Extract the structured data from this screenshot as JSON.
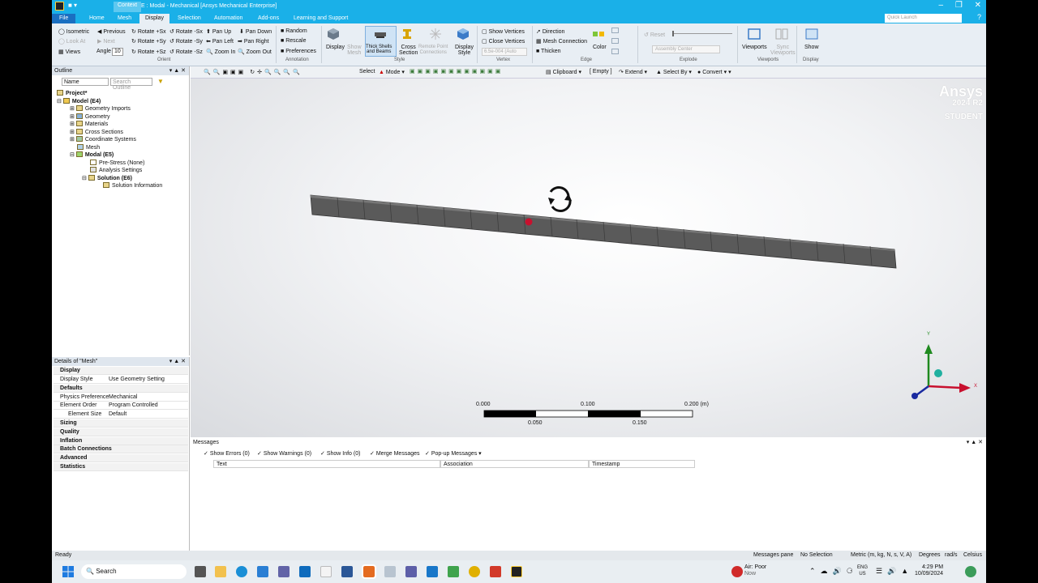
{
  "window": {
    "context_tab": "Context",
    "title": "E : Modal - Mechanical [Ansys Mechanical Enterprise]",
    "controls": [
      "–",
      "❐",
      "✕"
    ],
    "quick_launch_placeholder": "Quick Launch"
  },
  "ribbon_tabs": [
    "File",
    "Home",
    "Mesh",
    "Display",
    "Selection",
    "Automation",
    "Add-ons",
    "Learning and Support"
  ],
  "active_tab": "Display",
  "ribbon": {
    "orient": {
      "isometric": "Isometric",
      "previous": "Previous",
      "rotate_px": "Rotate +Sx",
      "rotate_mx": "Rotate -Sx",
      "pan_up": "Pan Up",
      "pan_down": "Pan Down",
      "look_at": "Look At",
      "next": "Next",
      "rotate_py": "Rotate +Sy",
      "rotate_my": "Rotate -Sy",
      "pan_left": "Pan Left",
      "pan_right": "Pan Right",
      "views": "Views",
      "angle_label": "Angle",
      "angle_value": "10",
      "rotate_pz": "Rotate +Sz",
      "rotate_mz": "Rotate -Sz",
      "zoom_in": "Zoom In",
      "zoom_out": "Zoom Out",
      "group": "Orient"
    },
    "annotation": {
      "random": "Random",
      "rescale": "Rescale",
      "preferences": "Preferences",
      "group": "Annotation"
    },
    "style": {
      "display": "Display",
      "show_mesh": "Show\nMesh",
      "thick": "Thick Shells\nand Beams",
      "cross": "Cross\nSection",
      "remote": "Remote Point\nConnections",
      "display_style": "Display\nStyle",
      "group": "Style"
    },
    "vertex": {
      "show": "Show Vertices",
      "close": "Close Vertices",
      "value": "6.5e-004 (Auto",
      "group": "Vertex"
    },
    "edge": {
      "direction": "Direction",
      "mesh_conn": "Mesh Connection",
      "thicken": "Thicken",
      "color": "Color",
      "group": "Edge"
    },
    "explode": {
      "reset": "Reset",
      "center": "Assembly Center",
      "group": "Explode"
    },
    "viewports": {
      "viewports": "Viewports",
      "sync": "Sync\nViewports",
      "group": "Viewports"
    },
    "display2": {
      "show": "Show",
      "group": "Display"
    }
  },
  "outline": {
    "title": "Outline",
    "filter_field": "Name",
    "search_placeholder": "Search Outline",
    "items": [
      "Project*",
      "Model (E4)",
      "Geometry Imports",
      "Geometry",
      "Materials",
      "Cross Sections",
      "Coordinate Systems",
      "Mesh",
      "Modal (E5)",
      "Pre-Stress (None)",
      "Analysis Settings",
      "Solution (E6)",
      "Solution Information"
    ]
  },
  "details": {
    "title": "Details of \"Mesh\"",
    "rows": [
      [
        "Display",
        ""
      ],
      [
        "Display Style",
        "Use Geometry Setting"
      ],
      [
        "Defaults",
        ""
      ],
      [
        "Physics Preference",
        "Mechanical"
      ],
      [
        "Element Order",
        "Program Controlled"
      ],
      [
        "Element Size",
        "Default"
      ],
      [
        "Sizing",
        ""
      ],
      [
        "Quality",
        ""
      ],
      [
        "Inflation",
        ""
      ],
      [
        "Batch Connections",
        ""
      ],
      [
        "Advanced",
        ""
      ],
      [
        "Statistics",
        ""
      ]
    ]
  },
  "viewtoolbar": {
    "select": "Select",
    "mode": "Mode",
    "clipboard": "Clipboard",
    "empty": "[ Empty ]",
    "extend": "Extend",
    "select_by": "Select By",
    "convert": "Convert"
  },
  "viewport": {
    "brand": "Ansys",
    "version": "2024 R2",
    "edition": "STUDENT",
    "scale_top": [
      "0.000",
      "0.100",
      "0.200 (m)"
    ],
    "scale_bottom": [
      "0.050",
      "0.150"
    ],
    "axis_x": "X",
    "axis_y": "Y"
  },
  "messages": {
    "title": "Messages",
    "show_errors": "Show Errors",
    "errors_count": "(0)",
    "show_warnings": "Show Warnings",
    "warnings_count": "(0)",
    "show_info": "Show Info",
    "info_count": "(0)",
    "merge": "Merge Messages",
    "popup": "Pop-up Messages",
    "columns": [
      "Text",
      "Association",
      "Timestamp"
    ]
  },
  "status": {
    "ready": "Ready",
    "pane": "Messages pane",
    "selection": "No Selection",
    "units": "Metric (m, kg, N, s, V, A)",
    "degrees": "Degrees",
    "rads": "rad/s",
    "celsius": "Celsius"
  },
  "taskbar": {
    "search": "Search",
    "air_title": "Air: Poor",
    "air_sub": "Now",
    "lang1": "ENG",
    "lang2": "US",
    "time": "4:29 PM",
    "date": "10/09/2024"
  }
}
